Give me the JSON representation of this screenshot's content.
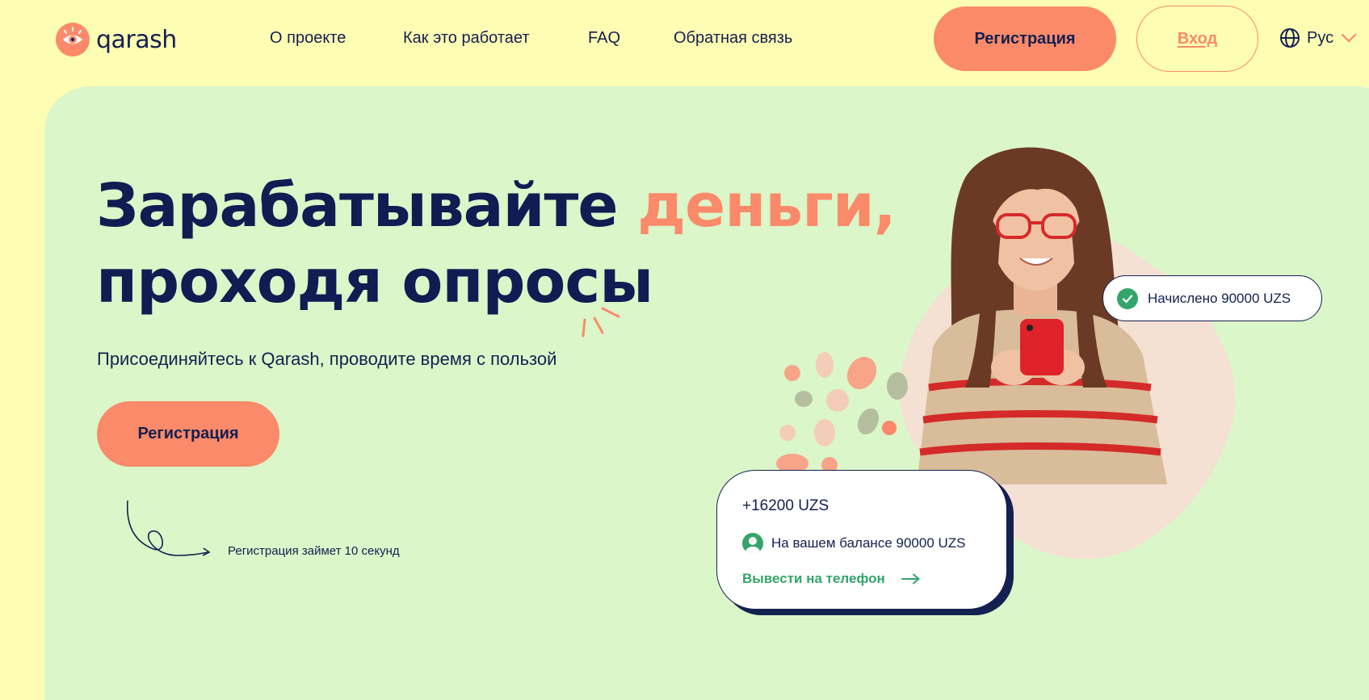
{
  "brand": {
    "name": "qarash",
    "color": "#fb8a6a"
  },
  "nav": {
    "items": [
      {
        "label": "О проекте"
      },
      {
        "label": "Как это работает"
      },
      {
        "label": "FAQ"
      },
      {
        "label": "Обратная связь"
      }
    ],
    "register_label": "Регистрация",
    "login_label": "Вход",
    "language": {
      "selected": "Рус",
      "icon": "globe-icon"
    }
  },
  "hero": {
    "title_part1": "Зарабатывайте",
    "title_accent": "деньги,",
    "title_line2": "проходя опросы",
    "subtitle": "Присоединяйтесь к Qarash, проводите время с пользой",
    "register_label": "Регистрация",
    "note": "Регистрация займет 10 секунд"
  },
  "notification": {
    "text": "Начислено 90000 UZS",
    "icon": "check-circle-icon"
  },
  "balance_card": {
    "amount": "+16200 UZS",
    "balance_text": "На вашем балансе 90000 UZS",
    "withdraw_label": "Вывести на телефон",
    "icon": "user-icon",
    "arrow_icon": "arrow-right-icon"
  },
  "colors": {
    "page_bg": "#fefdb4",
    "hero_bg": "#dbf6c9",
    "accent": "#fb8a6a",
    "text": "#14204f",
    "success": "#33a56a"
  }
}
